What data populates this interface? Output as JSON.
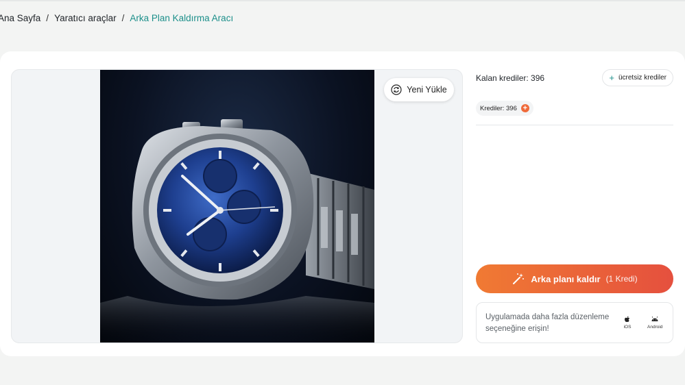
{
  "breadcrumb": {
    "home": "Ana Sayfa",
    "separator": "/",
    "section": "Yaratıcı araçlar",
    "current": "Arka Plan Kaldırma Aracı"
  },
  "preview": {
    "reupload_label": "Yeni Yükle"
  },
  "sidebar": {
    "credits_label": "Kalan krediler: 396",
    "free_credits_label": "ücretsiz krediler",
    "badge_label": "Krediler: 396",
    "remove_button_label": "Arka planı kaldır",
    "remove_button_cost": "(1 Kredi)",
    "app_promo_text": "Uygulamada daha fazla düzenleme seçeneğine erişin!",
    "stores": [
      {
        "label": "iOS",
        "icon": "apple-icon"
      },
      {
        "label": "Android",
        "icon": "android-icon"
      }
    ]
  },
  "colors": {
    "accent_teal": "#1c8f8a",
    "button_gradient_start": "#f07a33",
    "button_gradient_end": "#e5503e",
    "page_background": "#f3f4f3"
  }
}
